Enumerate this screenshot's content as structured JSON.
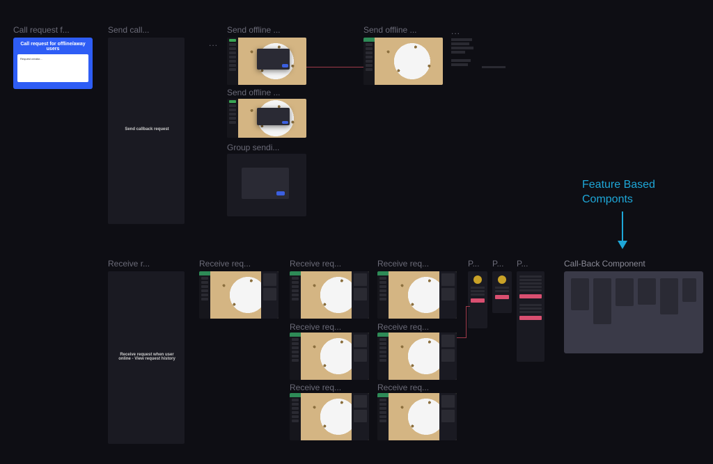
{
  "row1": {
    "card1_label": "Call request f...",
    "card1_title": "Call request for offline/away users",
    "card1_body": "Request creator...",
    "card2_label": "Send call...",
    "card2_body": "Send callback request",
    "col3": {
      "a": "Send offline ...",
      "b": "Send offline ...",
      "c": "Group sendi..."
    },
    "col4_label": "Send offline ..."
  },
  "row2": {
    "receive_label": "Receive r...",
    "receive_body": "Receive request when user online - View request history",
    "req_a": "Receive req...",
    "req_b": "Receive req...",
    "req_c": "Receive req...",
    "req_d": "Receive req...",
    "req_e": "Receive req...",
    "req_f": "Receive req...",
    "req_g": "Receive req...",
    "panel_a": "P...",
    "panel_b": "P...",
    "panel_c": "P..."
  },
  "annotation": {
    "line1": "Feature Based",
    "line2": "Componts",
    "component_label": "Call-Back Component"
  },
  "dots": "..."
}
